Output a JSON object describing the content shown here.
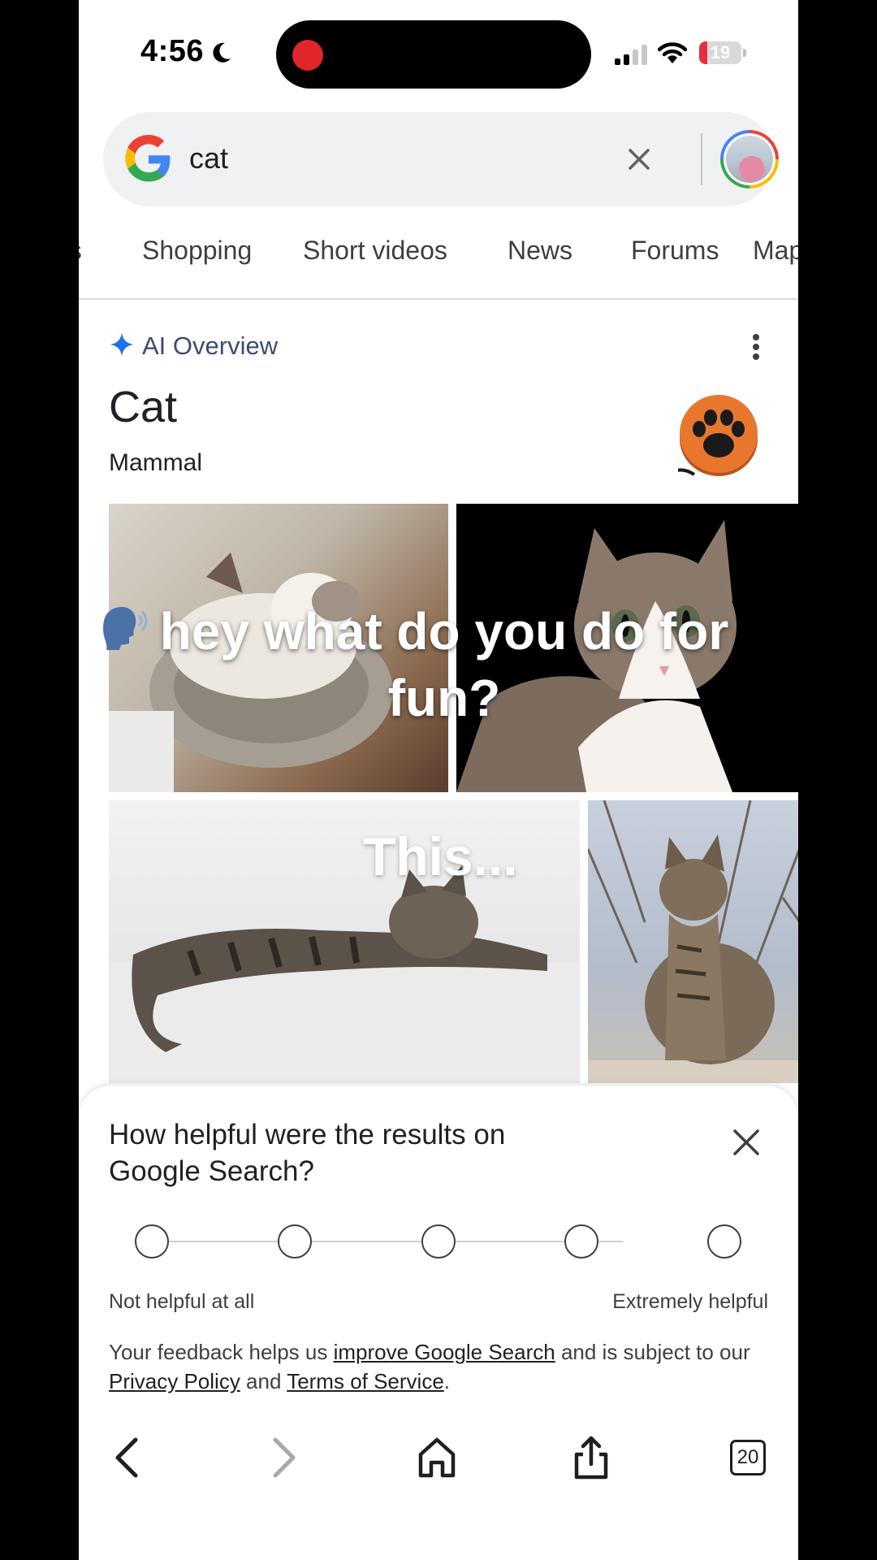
{
  "status_bar": {
    "time": "4:56",
    "battery": "19",
    "battery_level": 0.19
  },
  "search": {
    "query": "cat"
  },
  "tabs": [
    {
      "label": "os"
    },
    {
      "label": "Shopping"
    },
    {
      "label": "Short videos"
    },
    {
      "label": "News"
    },
    {
      "label": "Forums"
    },
    {
      "label": "Maps"
    }
  ],
  "ai_overview": {
    "label": "AI Overview",
    "title": "Cat",
    "subtitle": "Mammal"
  },
  "video_overlay": {
    "caption": "hey what do you do for fun?",
    "caption2": "This..."
  },
  "feedback": {
    "question": "How helpful were the results on Google Search?",
    "scale_low": "Not helpful at all",
    "scale_high": "Extremely helpful",
    "rating_count": 5,
    "footer_prefix": "Your feedback helps us ",
    "footer_link1": "improve Google Search",
    "footer_mid": " and is subject to our ",
    "footer_link2": "Privacy Policy",
    "footer_and": " and ",
    "footer_link3": "Terms of Service",
    "footer_end": "."
  },
  "toolbar": {
    "tab_count": "20"
  },
  "colors": {
    "accent_blue": "#1a73e8",
    "paw_orange": "#e8772e",
    "record_red": "#e0252b"
  }
}
